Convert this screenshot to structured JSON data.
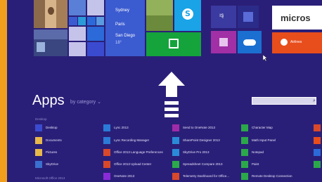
{
  "start_tiles": {
    "weather_cities": [
      "Sydney",
      "Paris",
      "San Diego"
    ],
    "weather_temp": "18°",
    "skype_letter": "S",
    "brand_tile_text": "micros",
    "brand_sub_text": "Airlines",
    "icons": [
      "people-icon",
      "skype-icon",
      "store-icon",
      "onedrive-icon",
      "maps-icon"
    ]
  },
  "apps_view": {
    "title": "Apps",
    "sort_label": "by category ⌄",
    "search_placeholder": "",
    "search_icon": "⌕",
    "categories": {
      "desktop": "Desktop",
      "office": "Microsoft Office 2013"
    },
    "columns": [
      {
        "items": [
          {
            "label": "Desktop",
            "color": "#3b4bd0"
          },
          {
            "label": "Documents",
            "color": "#e8b84a"
          },
          {
            "label": "Pictures",
            "color": "#e8b84a"
          },
          {
            "label": "SkyDrive",
            "color": "#3b6fd0"
          }
        ]
      },
      {
        "items": [
          {
            "label": "Lync 2013",
            "color": "#2b7ad8"
          },
          {
            "label": "Lync Recording Manager",
            "color": "#2b7ad8"
          },
          {
            "label": "Office 2013 Language Preferences",
            "color": "#d8482b"
          },
          {
            "label": "Office 2013 Upload Center",
            "color": "#d8482b"
          },
          {
            "label": "OneNote 2013",
            "color": "#8a2bd8"
          }
        ]
      },
      {
        "items": [
          {
            "label": "Send to OneNote 2013",
            "color": "#a02ba8"
          },
          {
            "label": "SharePoint Designer 2013",
            "color": "#2b8ad8"
          },
          {
            "label": "SkyDrive Pro 2013",
            "color": "#2b8ad8"
          },
          {
            "label": "Spreadsheet Compare 2013",
            "color": "#2ba84a"
          },
          {
            "label": "Telemetry Dashboard for Office...",
            "color": "#d8482b"
          }
        ]
      },
      {
        "items": [
          {
            "label": "Character Map",
            "color": "#2ba84a"
          },
          {
            "label": "Math Input Panel",
            "color": "#2ba84a"
          },
          {
            "label": "Notepad",
            "color": "#2ba84a"
          },
          {
            "label": "Paint",
            "color": "#2ba84a"
          },
          {
            "label": "Remote Desktop Connection",
            "color": "#2ba84a"
          }
        ]
      }
    ]
  },
  "colors": {
    "background": "#2a1f78",
    "frame": "#f29d1c",
    "store_tile": "#15a33c",
    "skype_tile": "#1aa3e6",
    "onedrive_tile": "#1b6fd1",
    "people_tile": "#e0572c",
    "music_tile": "#b4309c",
    "brand_tile": "#e84d1c"
  }
}
